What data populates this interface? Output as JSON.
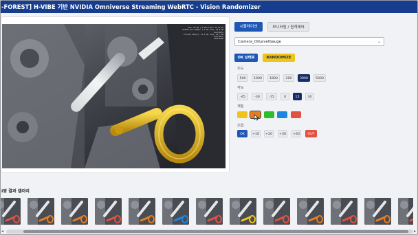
{
  "header": {
    "title": "-FOREST] H-VIBE 기반 NVIDIA Omniverse Streaming WebRTC - Vision Randomizer"
  },
  "viewer": {
    "overlay_lines": [
      "FPS: 60.00 | Frame time: 16.67 ms",
      "NVIDIA RTX A6000: 7.5 GB used, 40.0 GB available",
      "Process Memory: 13.9 GB used, 61.7 GB available",
      "1920x1080"
    ]
  },
  "panel": {
    "tabs": [
      {
        "label": "시뮬레이션",
        "active": true
      },
      {
        "label": "모니터링 / 원격제어",
        "active": false
      }
    ],
    "camera_select": {
      "value": "Camera_OilLevelGauge"
    },
    "ok_button": "OK 상태로",
    "randomize_button": "RANDOMIZE",
    "illum": {
      "label": "조도",
      "options": [
        "500",
        "1000",
        "1800",
        "200",
        "3000",
        "5000"
      ],
      "selected": "3000"
    },
    "angle": {
      "label": "각도",
      "options": [
        "-45",
        "-30",
        "-15",
        "0",
        "15",
        "30"
      ],
      "selected": "15"
    },
    "color": {
      "label": "재질",
      "swatches": [
        "#f0c419",
        "#e57e22",
        "#2dbd2d",
        "#1f86e0",
        "#e25241"
      ],
      "selected_index": 1
    },
    "level": {
      "label": "조합",
      "options": [
        "OK",
        "+10",
        "+20",
        "+30",
        "+40",
        "OUT"
      ]
    }
  },
  "gallery": {
    "title": "I영 결과 갤러리",
    "thumb_accents": [
      "#e25241",
      "#e57e22",
      "#e57e22",
      "#e25241",
      "#e57e22",
      "#1f86e0",
      "#e25241",
      "#f0c419",
      "#e25241",
      "#e57e22",
      "#e25241",
      "#e57e22",
      "#e25241"
    ]
  }
}
